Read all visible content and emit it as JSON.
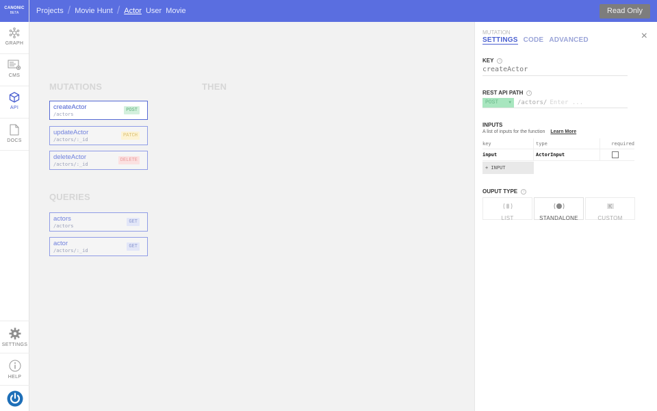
{
  "brand": {
    "name": "CANONIC",
    "tag": "BETA"
  },
  "breadcrumbs": {
    "projects": "Projects",
    "project": "Movie Hunt",
    "tabs": [
      "Actor",
      "User",
      "Movie"
    ]
  },
  "toolbar": {
    "read_only": "Read Only"
  },
  "sidebar": {
    "items": [
      {
        "label": "GRAPH",
        "icon": "graph-icon"
      },
      {
        "label": "CMS",
        "icon": "cms-icon"
      },
      {
        "label": "API",
        "icon": "api-cube-icon"
      },
      {
        "label": "DOCS",
        "icon": "docs-icon"
      }
    ],
    "bottom": [
      {
        "label": "SETTINGS",
        "icon": "gear-icon"
      },
      {
        "label": "HELP",
        "icon": "help-icon"
      }
    ]
  },
  "canvas": {
    "mutations_title": "MUTATIONS",
    "then_title": "THEN",
    "queries_title": "QUERIES",
    "mutations": [
      {
        "name": "createActor",
        "path": "/actors",
        "method": "POST"
      },
      {
        "name": "updateActor",
        "path": "/actors/:_id",
        "method": "PATCH"
      },
      {
        "name": "deleteActor",
        "path": "/actors/:_id",
        "method": "DELETE"
      }
    ],
    "queries": [
      {
        "name": "actors",
        "path": "/actors",
        "method": "GET"
      },
      {
        "name": "actor",
        "path": "/actors/:_id",
        "method": "GET"
      }
    ]
  },
  "panel": {
    "type": "MUTATION",
    "tabs": [
      "SETTINGS",
      "CODE",
      "ADVANCED"
    ],
    "key_label": "KEY",
    "key_value": "createActor",
    "rest_label": "REST API PATH",
    "rest_method": "POST",
    "rest_path": "/actors/",
    "rest_placeholder": "Enter ...",
    "inputs_label": "INPUTS",
    "inputs_desc": "A list of inputs for the function",
    "learn_more": "Learn More",
    "columns": [
      "key",
      "type",
      "required"
    ],
    "inputs": [
      {
        "key": "input",
        "type": "ActorInput",
        "required": false
      }
    ],
    "add_input": "+ INPUT",
    "output_label": "OUPUT TYPE",
    "output_types": [
      "LIST",
      "STANDALONE",
      "CUSTOM"
    ]
  }
}
